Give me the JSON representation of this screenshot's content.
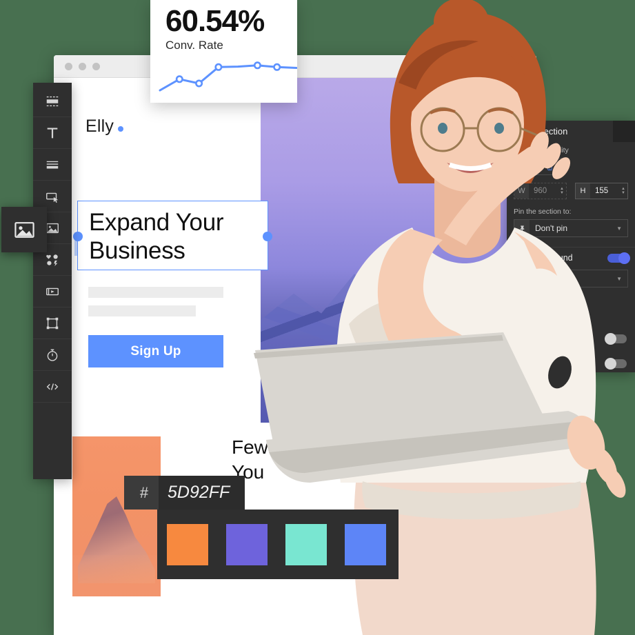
{
  "theme": {
    "page_background": "#487050",
    "accent_blue": "#5D92FF",
    "panel_dark": "#2F2F2F",
    "rail_dark": "#2F2F2F"
  },
  "browser": {
    "dots": [
      "dot-1",
      "dot-2",
      "dot-3"
    ]
  },
  "canvas": {
    "brand_name": "Elly",
    "heading_line1": "Expand Your",
    "heading_line2": "Business",
    "signup_label": "Sign Up",
    "bottom_heading_line1": "Few",
    "bottom_heading_line2": "You",
    "placeholder_bars": 2
  },
  "element_toolbar": {
    "buttons": [
      {
        "name": "duplicate-button",
        "icon": "duplicate-icon"
      },
      {
        "name": "resize-button",
        "icon": "resize-icon"
      },
      {
        "name": "delete-button",
        "icon": "trash-icon"
      }
    ],
    "drag_handle_icon": "move-icon"
  },
  "tool_rail": {
    "items": [
      {
        "name": "sidebar-item-section",
        "icon": "section-icon"
      },
      {
        "name": "sidebar-item-text",
        "icon": "text-icon"
      },
      {
        "name": "sidebar-item-list",
        "icon": "list-icon"
      },
      {
        "name": "sidebar-item-button",
        "icon": "button-pointer-icon"
      },
      {
        "name": "sidebar-item-image",
        "icon": "image-icon"
      },
      {
        "name": "sidebar-item-widgets",
        "icon": "widgets-icon"
      },
      {
        "name": "sidebar-item-video",
        "icon": "video-icon"
      },
      {
        "name": "sidebar-item-shape",
        "icon": "shape-icon"
      },
      {
        "name": "sidebar-item-timer",
        "icon": "timer-icon"
      },
      {
        "name": "sidebar-item-code",
        "icon": "code-icon"
      }
    ],
    "active_popup_icon": "image-icon"
  },
  "conversion_card": {
    "value": "60.54%",
    "label": "Conv. Rate"
  },
  "chart_data": {
    "type": "line",
    "title": "Conv. Rate",
    "x": [
      0,
      1,
      2,
      3,
      4,
      5,
      6,
      7
    ],
    "values": [
      8,
      34,
      24,
      62,
      63,
      66,
      62,
      60
    ],
    "marker_indices": [
      1,
      2,
      3,
      5,
      6
    ],
    "series": [
      {
        "name": "Conversion rate",
        "values": [
          8,
          34,
          24,
          62,
          63,
          66,
          62,
          60
        ]
      }
    ],
    "line_color": "#5D92FF",
    "marker_fill": "#FFFFFF",
    "grid": false,
    "xlabel": "",
    "ylabel": "",
    "ylim": [
      0,
      80
    ],
    "legend": "none"
  },
  "properties_panel": {
    "back_icon": "back-arrow-icon",
    "title": "Section",
    "collapse_icon": "minus-icon",
    "viewport": {
      "label": "Viewport visibility",
      "options": [
        {
          "name": "viewport-desktop",
          "icon": "monitor-icon",
          "active": true
        },
        {
          "name": "viewport-mobile",
          "icon": "phone-icon",
          "active": true
        }
      ]
    },
    "dimensions": {
      "width_key": "W",
      "width_value": "960",
      "height_key": "H",
      "height_value": "155"
    },
    "pin": {
      "label": "Pin the section to:",
      "icon": "pin-icon",
      "value": "Don't pin",
      "caret": "chevron-down-icon"
    },
    "background": {
      "caret": "chevron-up-icon",
      "label": "Background",
      "toggle_state": "on"
    },
    "extra_toggles": [
      {
        "name": "option-toggle-1",
        "state": "off"
      },
      {
        "name": "option-toggle-2",
        "state": "off"
      }
    ]
  },
  "color_picker": {
    "hash_symbol": "#",
    "hex_value": "5D92FF",
    "swatches": [
      {
        "name": "swatch-orange",
        "hex": "#F7893F"
      },
      {
        "name": "swatch-purple",
        "hex": "#6E63DC"
      },
      {
        "name": "swatch-teal",
        "hex": "#79E6D1"
      },
      {
        "name": "swatch-blue",
        "hex": "#5D85F7"
      }
    ]
  }
}
